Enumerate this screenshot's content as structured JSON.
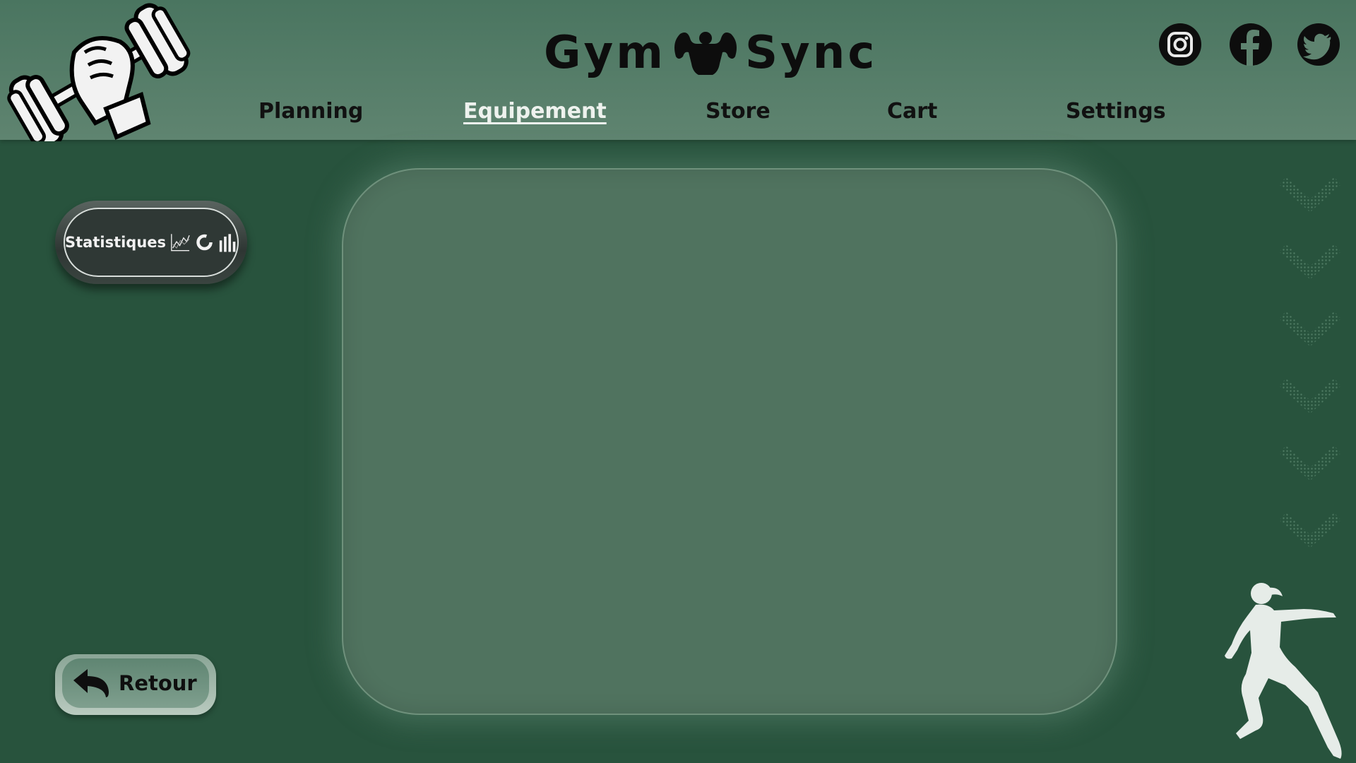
{
  "app": {
    "brand_left": "Gym",
    "brand_right": "Sync",
    "brand_icon": "muscle-torso-icon",
    "logo_icon": "dumbbell-hand-icon"
  },
  "nav": {
    "items": [
      {
        "label": "Planning",
        "active": false
      },
      {
        "label": "Equipement ",
        "active": true
      },
      {
        "label": "Store",
        "active": false
      },
      {
        "label": "Cart",
        "active": false
      },
      {
        "label": "Settings",
        "active": false
      }
    ]
  },
  "social": [
    {
      "icon": "instagram-icon"
    },
    {
      "icon": "facebook-icon"
    },
    {
      "icon": "twitter-icon"
    }
  ],
  "sidebar": {
    "stats_label": "Statistiques",
    "stats_icons": [
      "line-chart-icon",
      "donut-chart-icon",
      "bar-chart-icon"
    ],
    "back_label": "Retour",
    "back_icon": "back-arrow-icon"
  },
  "colors": {
    "background": "#28533d",
    "header": "#5f8470",
    "panel": "#50735f",
    "active_nav": "#eef2ee"
  }
}
